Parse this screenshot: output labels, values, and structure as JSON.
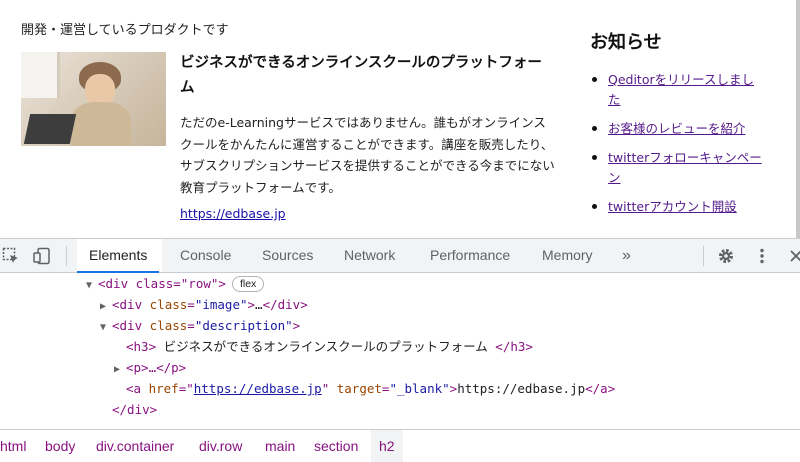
{
  "page": {
    "caption": "開発・運営しているプロダクトです",
    "product": {
      "title": "ビジネスができるオンラインスクールのプラットフォーム",
      "description": "ただのe-Learningサービスではありません。誰もがオンラインスクールをかんたんに運営することができます。講座を販売したり、サブスクリプションサービスを提供することができる今までにない教育プラットフォームです。",
      "link": "https://edbase.jp"
    },
    "news": {
      "title": "お知らせ",
      "items": [
        "Qeditorをリリースしました",
        "お客様のレビューを紹介",
        "twitterフォローキャンペーン",
        "twitterアカウント開設"
      ]
    }
  },
  "devtools": {
    "tabs": [
      "Elements",
      "Console",
      "Sources",
      "Network",
      "Performance",
      "Memory"
    ],
    "more_tabs": "»",
    "active_tab": "Elements",
    "dom": {
      "row_open": "<div class=\"row\">",
      "flex_badge": "flex",
      "image_tag": "div",
      "image_attr": "class",
      "image_val": "\"image\"",
      "image_ellipsis": "…",
      "desc_tag": "div",
      "desc_attr": "class",
      "desc_val": "\"description\"",
      "h3_open": "<h3>",
      "h3_text": " ビジネスができるオンラインスクールのプラットフォーム ",
      "h3_close": "</h3>",
      "p_collapsed": "<p>…</p>",
      "a_href_attr": "href",
      "a_href": "https://edbase.jp",
      "a_target_attr": "target",
      "a_target": "\"_blank\"",
      "a_text": "https://edbase.jp",
      "div_close": "</div>"
    },
    "breadcrumbs": [
      "html",
      "body",
      "div.container",
      "div.row",
      "main",
      "section",
      "h2"
    ]
  }
}
